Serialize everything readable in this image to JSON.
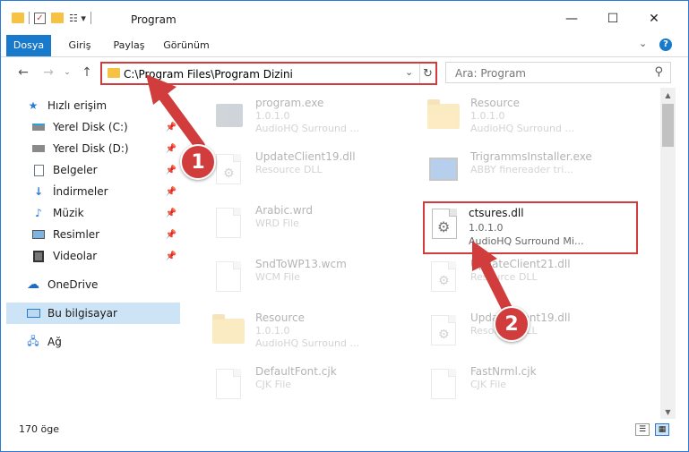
{
  "window": {
    "title": "Program",
    "minimize_glyph": "—",
    "maximize_glyph": "☐",
    "close_glyph": "✕"
  },
  "ribbon": {
    "tabs": [
      "Dosya",
      "Giriş",
      "Paylaş",
      "Görünüm"
    ],
    "file_color": "#1979ca"
  },
  "address": {
    "path": "C:\\Program Files\\Program Dizini",
    "search_placeholder": "Ara: Program"
  },
  "sidebar": {
    "items": [
      {
        "label": "Hızlı erişim",
        "icon": "star-icon"
      },
      {
        "label": "Yerel Disk (C:)",
        "icon": "drive-icon"
      },
      {
        "label": "Yerel Disk (D:)",
        "icon": "drive-icon"
      },
      {
        "label": "Belgeler",
        "icon": "documents-icon"
      },
      {
        "label": "İndirmeler",
        "icon": "download-icon"
      },
      {
        "label": "Müzik",
        "icon": "music-icon"
      },
      {
        "label": "Resimler",
        "icon": "pictures-icon"
      },
      {
        "label": "Videolar",
        "icon": "videos-icon"
      },
      {
        "label": "OneDrive",
        "icon": "cloud-icon"
      },
      {
        "label": "Bu bilgisayar",
        "icon": "computer-icon"
      },
      {
        "label": "Ağ",
        "icon": "network-icon"
      }
    ]
  },
  "files": [
    {
      "name": "program.exe",
      "sub1": "1.0.1.0",
      "sub2": "AudioHQ Surround Mi...",
      "kind": "exe"
    },
    {
      "name": "Resource",
      "sub1": "1.0.1.0",
      "sub2": "AudioHQ Surround Mi...",
      "kind": "folder"
    },
    {
      "name": "UpdateClient19.dll",
      "sub1": "Resource DLL",
      "sub2": "",
      "kind": "dll"
    },
    {
      "name": "TrigrammsInstaller.exe",
      "sub1": "ABBY finereader tri...",
      "sub2": "",
      "kind": "exe2"
    },
    {
      "name": "Arabic.wrd",
      "sub1": "WRD File",
      "sub2": "",
      "kind": "doc"
    },
    {
      "name": "ctsures.dll",
      "sub1": "1.0.1.0",
      "sub2": "AudioHQ Surround Mi...",
      "kind": "dll"
    },
    {
      "name": "SndToWP13.wcm",
      "sub1": "WCM File",
      "sub2": "",
      "kind": "doc"
    },
    {
      "name": "UpdateClient21.dll",
      "sub1": "Resource DLL",
      "sub2": "",
      "kind": "dll"
    },
    {
      "name": "Resource",
      "sub1": "1.0.1.0",
      "sub2": "AudioHQ Surround Mi...",
      "kind": "folder"
    },
    {
      "name": "UpdateClient19.dll",
      "sub1": "Resource DLL",
      "sub2": "",
      "kind": "dll"
    },
    {
      "name": "DefaultFont.cjk",
      "sub1": "CJK File",
      "sub2": "",
      "kind": "doc"
    },
    {
      "name": "FastNrml.cjk",
      "sub1": "CJK File",
      "sub2": "",
      "kind": "doc"
    }
  ],
  "status": {
    "count": "170 öge"
  },
  "callouts": [
    "1",
    "2"
  ],
  "colors": {
    "highlight": "#d13d3d",
    "selected_nav": "#cde3f6"
  }
}
